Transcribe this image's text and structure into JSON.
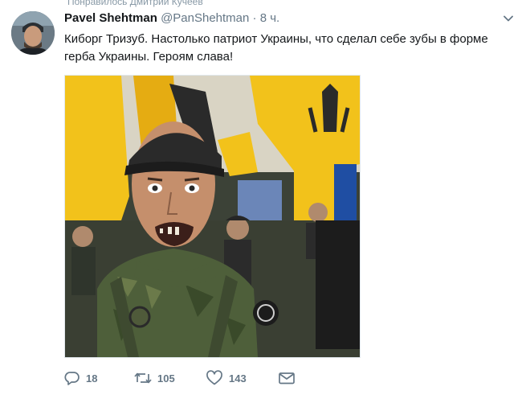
{
  "context": {
    "liked_by": "Понравилось Дмитрий Кучеев"
  },
  "tweet": {
    "author_name": "Pavel Shehtman",
    "author_handle": "@PanShehtman",
    "separator": " · ",
    "time": "8 ч.",
    "text": "Киборг Тризуб. Настолько патриот Украины, что сделал себе зубы в форме герба Украины. Героям слава!"
  },
  "actions": {
    "reply_count": "18",
    "retweet_count": "105",
    "like_count": "143"
  },
  "icons": {
    "reply": "reply-icon",
    "retweet": "retweet-icon",
    "like": "heart-icon",
    "message": "envelope-icon",
    "caret": "chevron-down-icon"
  },
  "colors": {
    "icon": "#657786",
    "text": "#14171a",
    "secondary": "#657786",
    "flag_yellow": "#f2c21b",
    "flag_blue": "#1f4ea3"
  }
}
